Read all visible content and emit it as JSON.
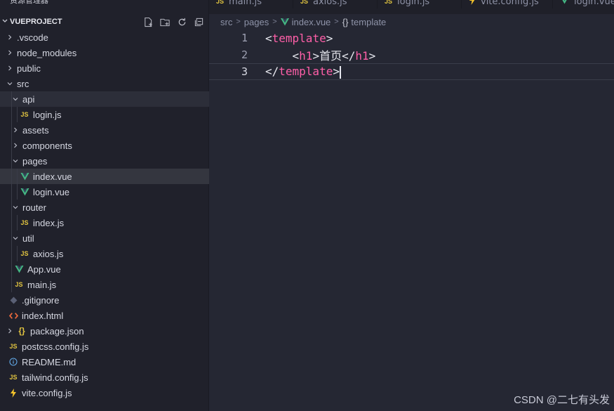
{
  "explorer": {
    "title": "资源管理器",
    "more": "···",
    "project_name": "VUEPROJECT"
  },
  "tree": [
    {
      "label": ".vscode",
      "depth": 0,
      "type": "folder",
      "state": "collapsed"
    },
    {
      "label": "node_modules",
      "depth": 0,
      "type": "folder",
      "state": "collapsed"
    },
    {
      "label": "public",
      "depth": 0,
      "type": "folder",
      "state": "collapsed"
    },
    {
      "label": "src",
      "depth": 0,
      "type": "folder",
      "state": "expanded"
    },
    {
      "label": "api",
      "depth": 1,
      "type": "folder",
      "state": "expanded"
    },
    {
      "label": "login.js",
      "depth": 2,
      "type": "js"
    },
    {
      "label": "assets",
      "depth": 1,
      "type": "folder",
      "state": "collapsed"
    },
    {
      "label": "components",
      "depth": 1,
      "type": "folder",
      "state": "collapsed"
    },
    {
      "label": "pages",
      "depth": 1,
      "type": "folder",
      "state": "expanded"
    },
    {
      "label": "index.vue",
      "depth": 2,
      "type": "vue"
    },
    {
      "label": "login.vue",
      "depth": 2,
      "type": "vue"
    },
    {
      "label": "router",
      "depth": 1,
      "type": "folder",
      "state": "expanded"
    },
    {
      "label": "index.js",
      "depth": 2,
      "type": "js"
    },
    {
      "label": "util",
      "depth": 1,
      "type": "folder",
      "state": "expanded"
    },
    {
      "label": "axios.js",
      "depth": 2,
      "type": "js"
    },
    {
      "label": "App.vue",
      "depth": 1,
      "type": "vue"
    },
    {
      "label": "main.js",
      "depth": 1,
      "type": "js"
    },
    {
      "label": ".gitignore",
      "depth": 0,
      "type": "git"
    },
    {
      "label": "index.html",
      "depth": 0,
      "type": "html"
    },
    {
      "label": "package.json",
      "depth": 0,
      "type": "json",
      "state": "collapsed"
    },
    {
      "label": "postcss.config.js",
      "depth": 0,
      "type": "js"
    },
    {
      "label": "README.md",
      "depth": 0,
      "type": "info"
    },
    {
      "label": "tailwind.config.js",
      "depth": 0,
      "type": "js"
    },
    {
      "label": "vite.config.js",
      "depth": 0,
      "type": "vite"
    }
  ],
  "tabs": [
    {
      "label": "main.js",
      "type": "js"
    },
    {
      "label": "axios.js",
      "type": "js"
    },
    {
      "label": "login.js",
      "type": "js"
    },
    {
      "label": "vite.config.js",
      "type": "vite"
    },
    {
      "label": "login.vue",
      "type": "vue"
    }
  ],
  "breadcrumb": {
    "parts": [
      "src",
      "pages",
      "index.vue",
      "template"
    ],
    "separator": ">"
  },
  "code": {
    "line_numbers": [
      "1",
      "2",
      "3"
    ],
    "tag_name": "template",
    "h1_tag": "h1",
    "h1_text": "首页"
  },
  "watermark": "CSDN @二七有头发",
  "colors": {
    "js": "#e2c540",
    "vue": "#44b883",
    "tag": "#ff5fa8",
    "selection": "#34363f"
  }
}
